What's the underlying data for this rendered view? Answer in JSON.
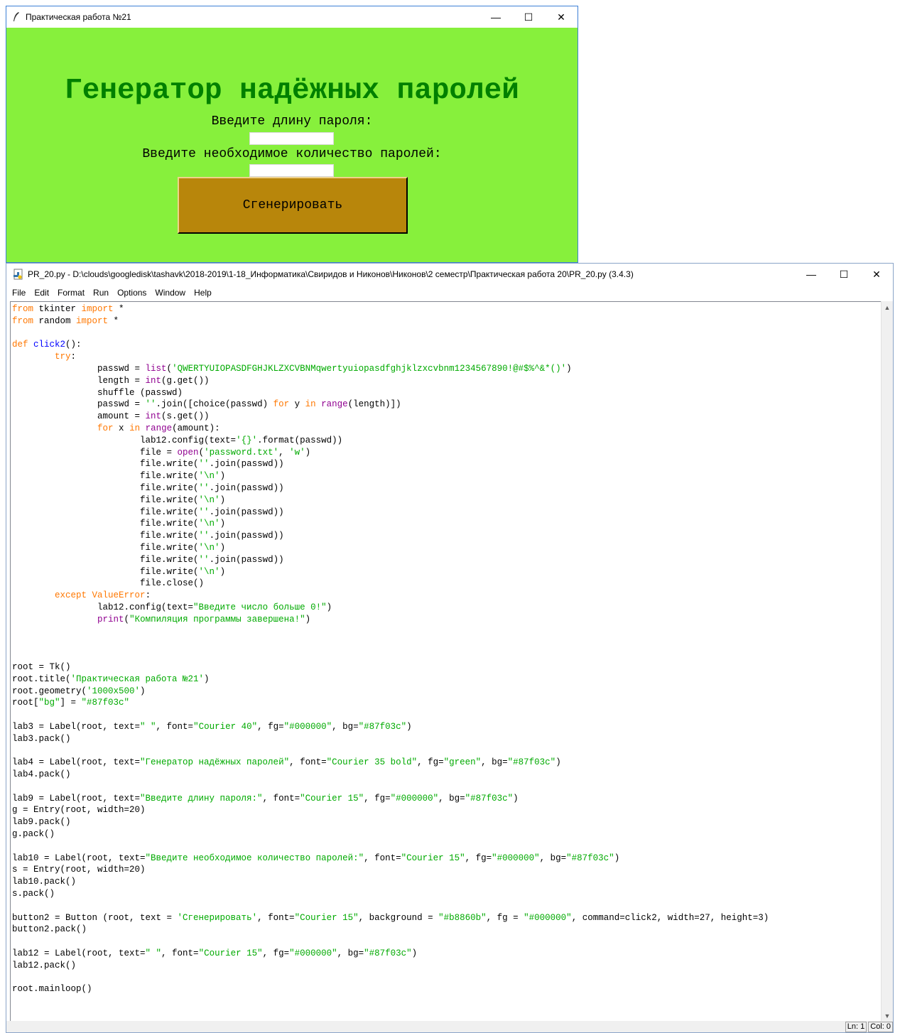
{
  "tk_window": {
    "title": "Практическая работа №21",
    "background": "#87f03c",
    "heading": "Генератор надёжных паролей",
    "length_label": "Введите длину пароля:",
    "count_label": "Введите необходимое количество паролей:",
    "length_value": "",
    "count_value": "",
    "generate_button": "Сгенерировать",
    "button_color": "#b8860b",
    "heading_color": "#008000"
  },
  "idle_window": {
    "title": "PR_20.py - D:\\clouds\\googledisk\\tashavk\\2018-2019\\1-18_Информатика\\Свиридов и Никонов\\Никонов\\2 семестр\\Практическая работа 20\\PR_20.py (3.4.3)",
    "menu": [
      "File",
      "Edit",
      "Format",
      "Run",
      "Options",
      "Window",
      "Help"
    ],
    "status": {
      "line": "Ln: 1",
      "col": "Col: 0"
    },
    "syntax_colors": {
      "keyword": "#ff7700",
      "definition": "#0000ff",
      "builtin": "#900090",
      "string": "#00aa00"
    },
    "code_lines": [
      [
        [
          "kw",
          "from"
        ],
        [
          "t",
          " tkinter "
        ],
        [
          "kw",
          "import"
        ],
        [
          "t",
          " *"
        ]
      ],
      [
        [
          "kw",
          "from"
        ],
        [
          "t",
          " random "
        ],
        [
          "kw",
          "import"
        ],
        [
          "t",
          " *"
        ]
      ],
      [],
      [
        [
          "kw",
          "def"
        ],
        [
          "t",
          " "
        ],
        [
          "fn",
          "click2"
        ],
        [
          "t",
          "():"
        ]
      ],
      [
        [
          "t",
          "        "
        ],
        [
          "kw",
          "try"
        ],
        [
          "t",
          ":"
        ]
      ],
      [
        [
          "t",
          "                passwd = "
        ],
        [
          "bi",
          "list"
        ],
        [
          "t",
          "("
        ],
        [
          "st",
          "'QWERTYUIOPASDFGHJKLZXCVBNMqwertyuiopasdfghjklzxcvbnm1234567890!@#$%^&*()'"
        ],
        [
          "t",
          ")"
        ]
      ],
      [
        [
          "t",
          "                length = "
        ],
        [
          "bi",
          "int"
        ],
        [
          "t",
          "(g.get())"
        ]
      ],
      [
        [
          "t",
          "                shuffle (passwd)"
        ]
      ],
      [
        [
          "t",
          "                passwd = "
        ],
        [
          "st",
          "''"
        ],
        [
          "t",
          ".join([choice(passwd) "
        ],
        [
          "kw",
          "for"
        ],
        [
          "t",
          " y "
        ],
        [
          "kw",
          "in"
        ],
        [
          "t",
          " "
        ],
        [
          "bi",
          "range"
        ],
        [
          "t",
          "(length)])"
        ]
      ],
      [
        [
          "t",
          "                amount = "
        ],
        [
          "bi",
          "int"
        ],
        [
          "t",
          "(s.get())"
        ]
      ],
      [
        [
          "t",
          "                "
        ],
        [
          "kw",
          "for"
        ],
        [
          "t",
          " x "
        ],
        [
          "kw",
          "in"
        ],
        [
          "t",
          " "
        ],
        [
          "bi",
          "range"
        ],
        [
          "t",
          "(amount):"
        ]
      ],
      [
        [
          "t",
          "                        lab12.config(text="
        ],
        [
          "st",
          "'{}'"
        ],
        [
          "t",
          ".format(passwd))"
        ]
      ],
      [
        [
          "t",
          "                        file = "
        ],
        [
          "bi",
          "open"
        ],
        [
          "t",
          "("
        ],
        [
          "st",
          "'password.txt'"
        ],
        [
          "t",
          ", "
        ],
        [
          "st",
          "'w'"
        ],
        [
          "t",
          ")"
        ]
      ],
      [
        [
          "t",
          "                        file.write("
        ],
        [
          "st",
          "''"
        ],
        [
          "t",
          ".join(passwd))"
        ]
      ],
      [
        [
          "t",
          "                        file.write("
        ],
        [
          "st",
          "'\\n'"
        ],
        [
          "t",
          ")"
        ]
      ],
      [
        [
          "t",
          "                        file.write("
        ],
        [
          "st",
          "''"
        ],
        [
          "t",
          ".join(passwd))"
        ]
      ],
      [
        [
          "t",
          "                        file.write("
        ],
        [
          "st",
          "'\\n'"
        ],
        [
          "t",
          ")"
        ]
      ],
      [
        [
          "t",
          "                        file.write("
        ],
        [
          "st",
          "''"
        ],
        [
          "t",
          ".join(passwd))"
        ]
      ],
      [
        [
          "t",
          "                        file.write("
        ],
        [
          "st",
          "'\\n'"
        ],
        [
          "t",
          ")"
        ]
      ],
      [
        [
          "t",
          "                        file.write("
        ],
        [
          "st",
          "''"
        ],
        [
          "t",
          ".join(passwd))"
        ]
      ],
      [
        [
          "t",
          "                        file.write("
        ],
        [
          "st",
          "'\\n'"
        ],
        [
          "t",
          ")"
        ]
      ],
      [
        [
          "t",
          "                        file.write("
        ],
        [
          "st",
          "''"
        ],
        [
          "t",
          ".join(passwd))"
        ]
      ],
      [
        [
          "t",
          "                        file.write("
        ],
        [
          "st",
          "'\\n'"
        ],
        [
          "t",
          ")"
        ]
      ],
      [
        [
          "t",
          "                        file.close()"
        ]
      ],
      [
        [
          "t",
          "        "
        ],
        [
          "kw",
          "except"
        ],
        [
          "t",
          " "
        ],
        [
          "kw",
          "ValueError"
        ],
        [
          "t",
          ":"
        ]
      ],
      [
        [
          "t",
          "                lab12.config(text="
        ],
        [
          "st",
          "\"Введите число больше 0!\""
        ],
        [
          "t",
          ")"
        ]
      ],
      [
        [
          "t",
          "                "
        ],
        [
          "bi",
          "print"
        ],
        [
          "t",
          "("
        ],
        [
          "st",
          "\"Компиляция программы завершена!\""
        ],
        [
          "t",
          ")"
        ]
      ],
      [],
      [],
      [],
      [
        [
          "t",
          "root = Tk()"
        ]
      ],
      [
        [
          "t",
          "root.title("
        ],
        [
          "st",
          "'Практическая работа №21'"
        ],
        [
          "t",
          ")"
        ]
      ],
      [
        [
          "t",
          "root.geometry("
        ],
        [
          "st",
          "'1000x500'"
        ],
        [
          "t",
          ")"
        ]
      ],
      [
        [
          "t",
          "root["
        ],
        [
          "st",
          "\"bg\""
        ],
        [
          "t",
          "] = "
        ],
        [
          "st",
          "\"#87f03c\""
        ]
      ],
      [],
      [
        [
          "t",
          "lab3 = Label(root, text="
        ],
        [
          "st",
          "\" \""
        ],
        [
          "t",
          ", font="
        ],
        [
          "st",
          "\"Courier 40\""
        ],
        [
          "t",
          ", fg="
        ],
        [
          "st",
          "\"#000000\""
        ],
        [
          "t",
          ", bg="
        ],
        [
          "st",
          "\"#87f03c\""
        ],
        [
          "t",
          ")"
        ]
      ],
      [
        [
          "t",
          "lab3.pack()"
        ]
      ],
      [],
      [
        [
          "t",
          "lab4 = Label(root, text="
        ],
        [
          "st",
          "\"Генератор надёжных паролей\""
        ],
        [
          "t",
          ", font="
        ],
        [
          "st",
          "\"Courier 35 bold\""
        ],
        [
          "t",
          ", fg="
        ],
        [
          "st",
          "\"green\""
        ],
        [
          "t",
          ", bg="
        ],
        [
          "st",
          "\"#87f03c\""
        ],
        [
          "t",
          ")"
        ]
      ],
      [
        [
          "t",
          "lab4.pack()"
        ]
      ],
      [],
      [
        [
          "t",
          "lab9 = Label(root, text="
        ],
        [
          "st",
          "\"Введите длину пароля:\""
        ],
        [
          "t",
          ", font="
        ],
        [
          "st",
          "\"Courier 15\""
        ],
        [
          "t",
          ", fg="
        ],
        [
          "st",
          "\"#000000\""
        ],
        [
          "t",
          ", bg="
        ],
        [
          "st",
          "\"#87f03c\""
        ],
        [
          "t",
          ")"
        ]
      ],
      [
        [
          "t",
          "g = Entry(root, width=20)"
        ]
      ],
      [
        [
          "t",
          "lab9.pack()"
        ]
      ],
      [
        [
          "t",
          "g.pack()"
        ]
      ],
      [],
      [
        [
          "t",
          "lab10 = Label(root, text="
        ],
        [
          "st",
          "\"Введите необходимое количество паролей:\""
        ],
        [
          "t",
          ", font="
        ],
        [
          "st",
          "\"Courier 15\""
        ],
        [
          "t",
          ", fg="
        ],
        [
          "st",
          "\"#000000\""
        ],
        [
          "t",
          ", bg="
        ],
        [
          "st",
          "\"#87f03c\""
        ],
        [
          "t",
          ")"
        ]
      ],
      [
        [
          "t",
          "s = Entry(root, width=20)"
        ]
      ],
      [
        [
          "t",
          "lab10.pack()"
        ]
      ],
      [
        [
          "t",
          "s.pack()"
        ]
      ],
      [],
      [
        [
          "t",
          "button2 = Button (root, text = "
        ],
        [
          "st",
          "'Сгенерировать'"
        ],
        [
          "t",
          ", font="
        ],
        [
          "st",
          "\"Courier 15\""
        ],
        [
          "t",
          ", background = "
        ],
        [
          "st",
          "\"#b8860b\""
        ],
        [
          "t",
          ", fg = "
        ],
        [
          "st",
          "\"#000000\""
        ],
        [
          "t",
          ", command=click2, width=27, height=3)"
        ]
      ],
      [
        [
          "t",
          "button2.pack()"
        ]
      ],
      [],
      [
        [
          "t",
          "lab12 = Label(root, text="
        ],
        [
          "st",
          "\" \""
        ],
        [
          "t",
          ", font="
        ],
        [
          "st",
          "\"Courier 15\""
        ],
        [
          "t",
          ", fg="
        ],
        [
          "st",
          "\"#000000\""
        ],
        [
          "t",
          ", bg="
        ],
        [
          "st",
          "\"#87f03c\""
        ],
        [
          "t",
          ")"
        ]
      ],
      [
        [
          "t",
          "lab12.pack()"
        ]
      ],
      [],
      [
        [
          "t",
          "root.mainloop()"
        ]
      ]
    ]
  }
}
